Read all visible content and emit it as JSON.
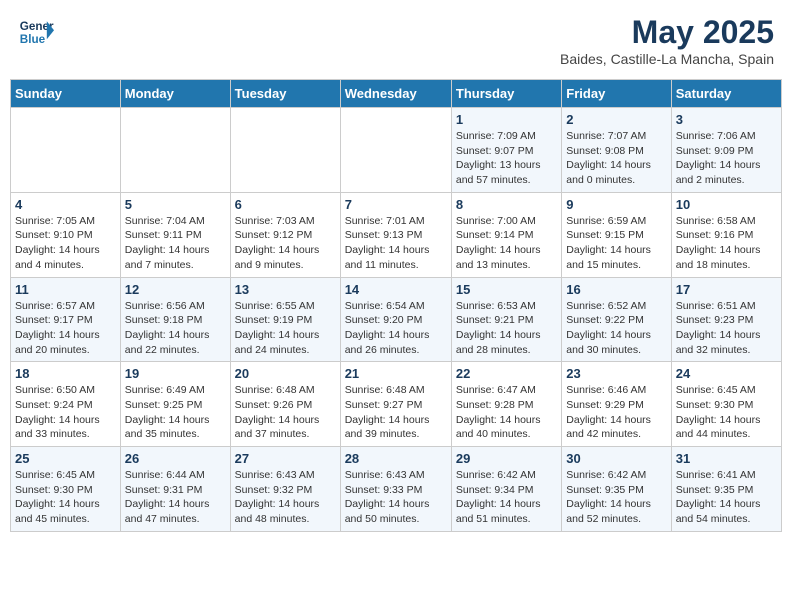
{
  "header": {
    "logo_line1": "General",
    "logo_line2": "Blue",
    "title": "May 2025",
    "subtitle": "Baides, Castille-La Mancha, Spain"
  },
  "days_of_week": [
    "Sunday",
    "Monday",
    "Tuesday",
    "Wednesday",
    "Thursday",
    "Friday",
    "Saturday"
  ],
  "weeks": [
    [
      {
        "day": "",
        "info": ""
      },
      {
        "day": "",
        "info": ""
      },
      {
        "day": "",
        "info": ""
      },
      {
        "day": "",
        "info": ""
      },
      {
        "day": "1",
        "info": "Sunrise: 7:09 AM\nSunset: 9:07 PM\nDaylight: 13 hours and 57 minutes."
      },
      {
        "day": "2",
        "info": "Sunrise: 7:07 AM\nSunset: 9:08 PM\nDaylight: 14 hours and 0 minutes."
      },
      {
        "day": "3",
        "info": "Sunrise: 7:06 AM\nSunset: 9:09 PM\nDaylight: 14 hours and 2 minutes."
      }
    ],
    [
      {
        "day": "4",
        "info": "Sunrise: 7:05 AM\nSunset: 9:10 PM\nDaylight: 14 hours and 4 minutes."
      },
      {
        "day": "5",
        "info": "Sunrise: 7:04 AM\nSunset: 9:11 PM\nDaylight: 14 hours and 7 minutes."
      },
      {
        "day": "6",
        "info": "Sunrise: 7:03 AM\nSunset: 9:12 PM\nDaylight: 14 hours and 9 minutes."
      },
      {
        "day": "7",
        "info": "Sunrise: 7:01 AM\nSunset: 9:13 PM\nDaylight: 14 hours and 11 minutes."
      },
      {
        "day": "8",
        "info": "Sunrise: 7:00 AM\nSunset: 9:14 PM\nDaylight: 14 hours and 13 minutes."
      },
      {
        "day": "9",
        "info": "Sunrise: 6:59 AM\nSunset: 9:15 PM\nDaylight: 14 hours and 15 minutes."
      },
      {
        "day": "10",
        "info": "Sunrise: 6:58 AM\nSunset: 9:16 PM\nDaylight: 14 hours and 18 minutes."
      }
    ],
    [
      {
        "day": "11",
        "info": "Sunrise: 6:57 AM\nSunset: 9:17 PM\nDaylight: 14 hours and 20 minutes."
      },
      {
        "day": "12",
        "info": "Sunrise: 6:56 AM\nSunset: 9:18 PM\nDaylight: 14 hours and 22 minutes."
      },
      {
        "day": "13",
        "info": "Sunrise: 6:55 AM\nSunset: 9:19 PM\nDaylight: 14 hours and 24 minutes."
      },
      {
        "day": "14",
        "info": "Sunrise: 6:54 AM\nSunset: 9:20 PM\nDaylight: 14 hours and 26 minutes."
      },
      {
        "day": "15",
        "info": "Sunrise: 6:53 AM\nSunset: 9:21 PM\nDaylight: 14 hours and 28 minutes."
      },
      {
        "day": "16",
        "info": "Sunrise: 6:52 AM\nSunset: 9:22 PM\nDaylight: 14 hours and 30 minutes."
      },
      {
        "day": "17",
        "info": "Sunrise: 6:51 AM\nSunset: 9:23 PM\nDaylight: 14 hours and 32 minutes."
      }
    ],
    [
      {
        "day": "18",
        "info": "Sunrise: 6:50 AM\nSunset: 9:24 PM\nDaylight: 14 hours and 33 minutes."
      },
      {
        "day": "19",
        "info": "Sunrise: 6:49 AM\nSunset: 9:25 PM\nDaylight: 14 hours and 35 minutes."
      },
      {
        "day": "20",
        "info": "Sunrise: 6:48 AM\nSunset: 9:26 PM\nDaylight: 14 hours and 37 minutes."
      },
      {
        "day": "21",
        "info": "Sunrise: 6:48 AM\nSunset: 9:27 PM\nDaylight: 14 hours and 39 minutes."
      },
      {
        "day": "22",
        "info": "Sunrise: 6:47 AM\nSunset: 9:28 PM\nDaylight: 14 hours and 40 minutes."
      },
      {
        "day": "23",
        "info": "Sunrise: 6:46 AM\nSunset: 9:29 PM\nDaylight: 14 hours and 42 minutes."
      },
      {
        "day": "24",
        "info": "Sunrise: 6:45 AM\nSunset: 9:30 PM\nDaylight: 14 hours and 44 minutes."
      }
    ],
    [
      {
        "day": "25",
        "info": "Sunrise: 6:45 AM\nSunset: 9:30 PM\nDaylight: 14 hours and 45 minutes."
      },
      {
        "day": "26",
        "info": "Sunrise: 6:44 AM\nSunset: 9:31 PM\nDaylight: 14 hours and 47 minutes."
      },
      {
        "day": "27",
        "info": "Sunrise: 6:43 AM\nSunset: 9:32 PM\nDaylight: 14 hours and 48 minutes."
      },
      {
        "day": "28",
        "info": "Sunrise: 6:43 AM\nSunset: 9:33 PM\nDaylight: 14 hours and 50 minutes."
      },
      {
        "day": "29",
        "info": "Sunrise: 6:42 AM\nSunset: 9:34 PM\nDaylight: 14 hours and 51 minutes."
      },
      {
        "day": "30",
        "info": "Sunrise: 6:42 AM\nSunset: 9:35 PM\nDaylight: 14 hours and 52 minutes."
      },
      {
        "day": "31",
        "info": "Sunrise: 6:41 AM\nSunset: 9:35 PM\nDaylight: 14 hours and 54 minutes."
      }
    ]
  ]
}
